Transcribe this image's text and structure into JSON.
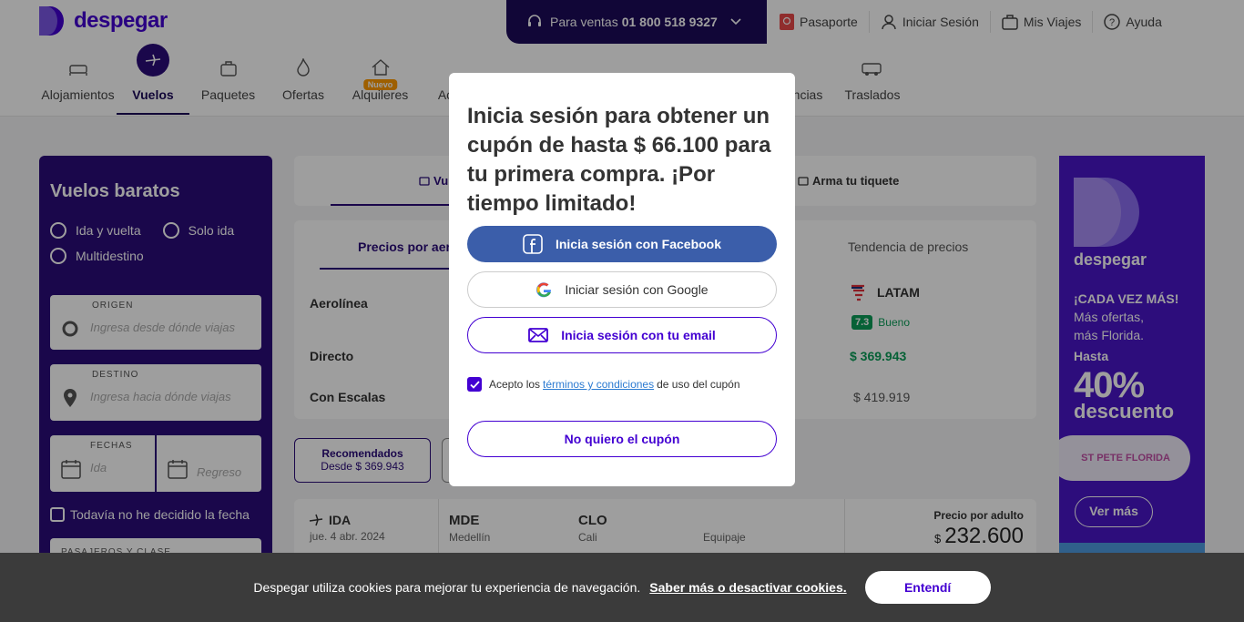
{
  "header": {
    "brand": "despegar",
    "sales_label": "Para ventas",
    "sales_phone": "01 800 518 9327",
    "links": [
      "Pasaporte",
      "Iniciar Sesión",
      "Mis Viajes",
      "Ayuda"
    ]
  },
  "products": {
    "items": [
      "Alojamientos",
      "Vuelos",
      "Paquetes",
      "Ofertas",
      "Alquileres",
      "Ac",
      "ncias",
      "Traslados"
    ],
    "new_badge": "Nuevo"
  },
  "search": {
    "title": "Vuelos baratos",
    "trip_types": [
      "Ida y vuelta",
      "Solo ida",
      "Multidestino"
    ],
    "origin_label": "ORIGEN",
    "origin_placeholder": "Ingresa desde dónde viajas",
    "destination_label": "DESTINO",
    "destination_placeholder": "Ingresa hacia dónde viajas",
    "dates_label": "FECHAS",
    "date_out_placeholder": "Ida",
    "date_back_placeholder": "Regreso",
    "undecided": "Todavía no he decidido la fecha",
    "passengers_label": "PASAJEROS Y CLASE"
  },
  "tabs": {
    "flights": "Vu",
    "build": "Arma tu tiquete"
  },
  "compare": {
    "tab_prices": "Precios por aer",
    "tab_trend": "Tendencia de precios",
    "row_airline": "Aerolínea",
    "row_direct": "Directo",
    "row_stops": "Con Escalas",
    "airline_name": "LATAM",
    "rating_score": "7.3",
    "rating_text": "Bueno",
    "direct_price": "$ 369.943",
    "stops_price": "$ 419.919"
  },
  "sort": {
    "label": "Recomendados",
    "sub": "Desde $ 369.943"
  },
  "flight": {
    "direction": "IDA",
    "date": "jue. 4 abr. 2024",
    "from_code": "MDE",
    "from_city": "Medellín",
    "to_code": "CLO",
    "to_city": "Cali",
    "baggage": "Equipaje",
    "price_label": "Precio por adulto",
    "currency": "$",
    "price": "232.600"
  },
  "ad": {
    "brand": "despegar",
    "slogan_bold": "¡CADA VEZ MÁS!",
    "slogan_1": "Más ofertas,",
    "slogan_2": "más Florida.",
    "hasta": "Hasta",
    "pct": "40%",
    "desc": "descuento",
    "partner": "ST PETE FLORIDA",
    "cta": "Ver más"
  },
  "modal": {
    "title": "Inicia sesión para obtener un cupón de hasta $ 66.100 para tu primera compra. ¡Por tiempo limitado!",
    "facebook": "Inicia sesión con Facebook",
    "google": "Iniciar sesión con Google",
    "email": "Inicia sesión con tu email",
    "terms_pre": "Acepto los",
    "terms_link": "términos y condiciones",
    "terms_post": "de uso del cupón",
    "decline": "No quiero el cupón"
  },
  "cookie": {
    "text": "Despegar utiliza cookies para mejorar tu experiencia de navegación.",
    "link": "Saber más o desactivar cookies.",
    "accept": "Entendí"
  },
  "colors": {
    "brand_purple": "#4300d2",
    "dark_purple": "#2b0c7a",
    "facebook_blue": "#3b5eaa",
    "green": "#0a9d58"
  }
}
